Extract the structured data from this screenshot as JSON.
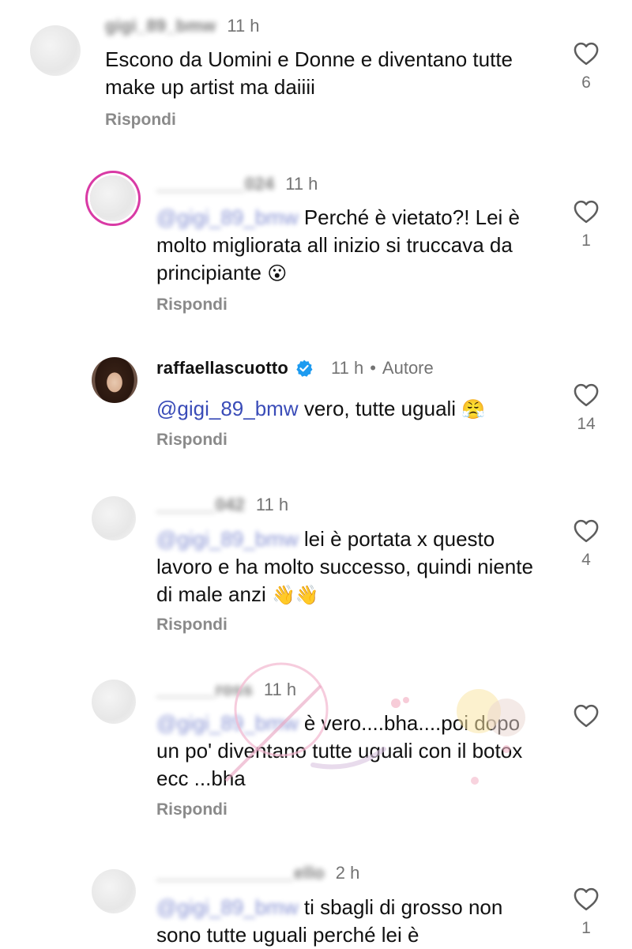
{
  "reply_label": "Rispondi",
  "comments": [
    {
      "username": "gigi_89_bmw",
      "time": "11 h",
      "text": "Escono da Uomini e Donne e diventano tutte make up artist  ma daiiii",
      "likes": "6"
    },
    {
      "username": "_________024",
      "time": "11 h",
      "mention": "@gigi_89_bmw",
      "text": "Perché è vietato?! Lei è molto migliorata all inizio si truccava da principiante",
      "emoji": "😮",
      "likes": "1"
    },
    {
      "username": "raffaellascuotto",
      "time": "11 h",
      "author_label": "Autore",
      "mention": "@gigi_89_bmw",
      "text": "vero, tutte uguali",
      "emoji": "😤",
      "likes": "14"
    },
    {
      "username": "______042",
      "time": "11 h",
      "mention": "@gigi_89_bmw",
      "text": "lei è portata x questo lavoro e ha molto successo, quindi niente di male anzi",
      "emoji": "👋👋",
      "likes": "4"
    },
    {
      "username": "______ross",
      "time": "11 h",
      "mention": "@gigi_89_bmw",
      "text": "è vero....bha....poi dopo un po' diventano tutte uguali con il botox ecc ...bha",
      "likes": ""
    },
    {
      "username": "______________ello",
      "time": "2 h",
      "mention": "@gigi_89_bmw",
      "text": "ti sbagli di grosso non sono tutte uguali perché lei è",
      "likes": "1"
    }
  ],
  "icons": {
    "heart": "heart-outline-icon",
    "verified": "verified-badge-icon"
  },
  "colors": {
    "mention": "#3a4cb8",
    "verified": "#1d9bf0",
    "secondary_text": "#737373"
  }
}
